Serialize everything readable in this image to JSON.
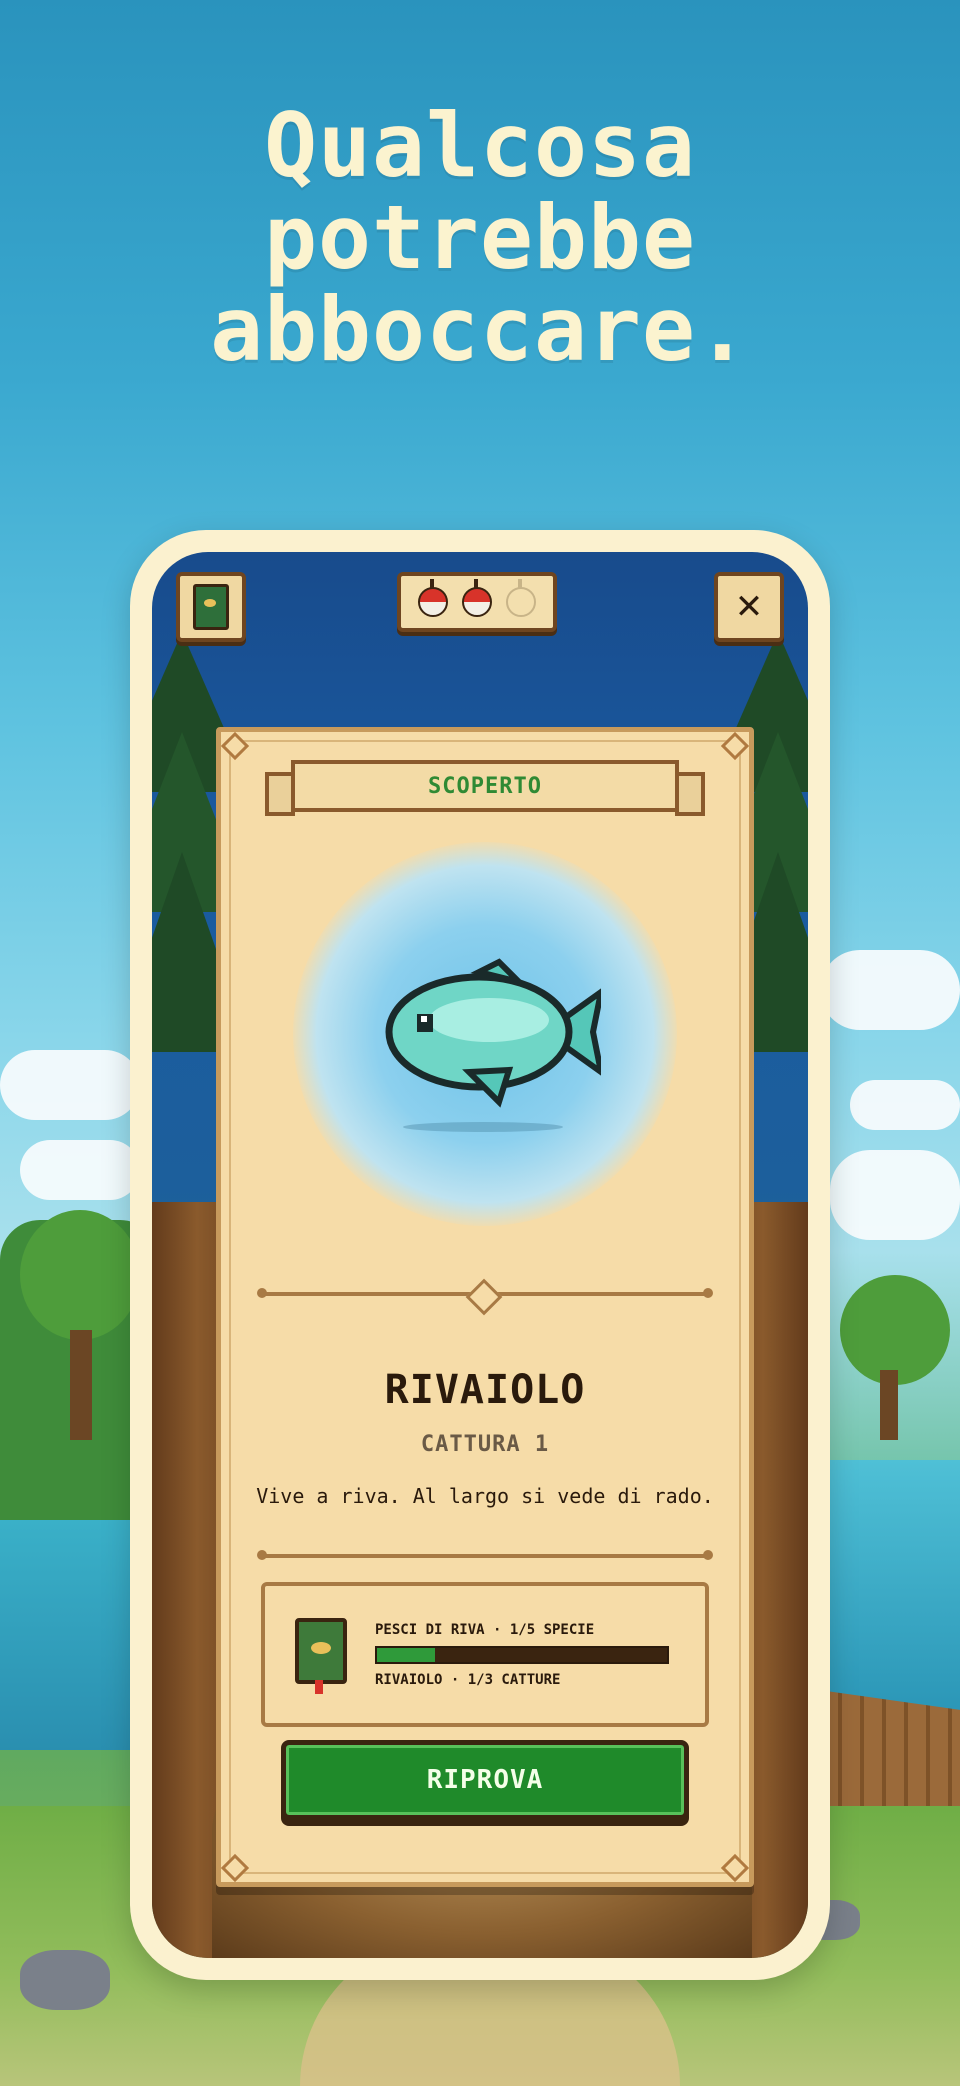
{
  "headline": {
    "line1": "Qualcosa",
    "line2": "potrebbe",
    "line3": "abboccare."
  },
  "top_bar": {
    "left_icon": "journal-book-icon",
    "bait_slots": [
      "full",
      "full",
      "empty"
    ],
    "close_label": "✕"
  },
  "card": {
    "ribbon_label": "SCOPERTO",
    "fish_icon": "fish-icon",
    "fish_name": "RIVAIOLO",
    "capture_label": "CATTURA 1",
    "description": "Vive a riva. Al largo si vede di rado.",
    "progress": {
      "icon": "journal-book-icon",
      "label1": "PESCI DI RIVA · 1/5 SPECIE",
      "label2": "RIVAIOLO · 1/3 CATTURE",
      "fraction": 0.2
    },
    "retry_label": "RIPROVA"
  },
  "colors": {
    "accent_green": "#1f8a2a",
    "ribbon_text": "#2f8a34",
    "card_bg": "#f6dca8",
    "headline": "#fbf3cf"
  }
}
